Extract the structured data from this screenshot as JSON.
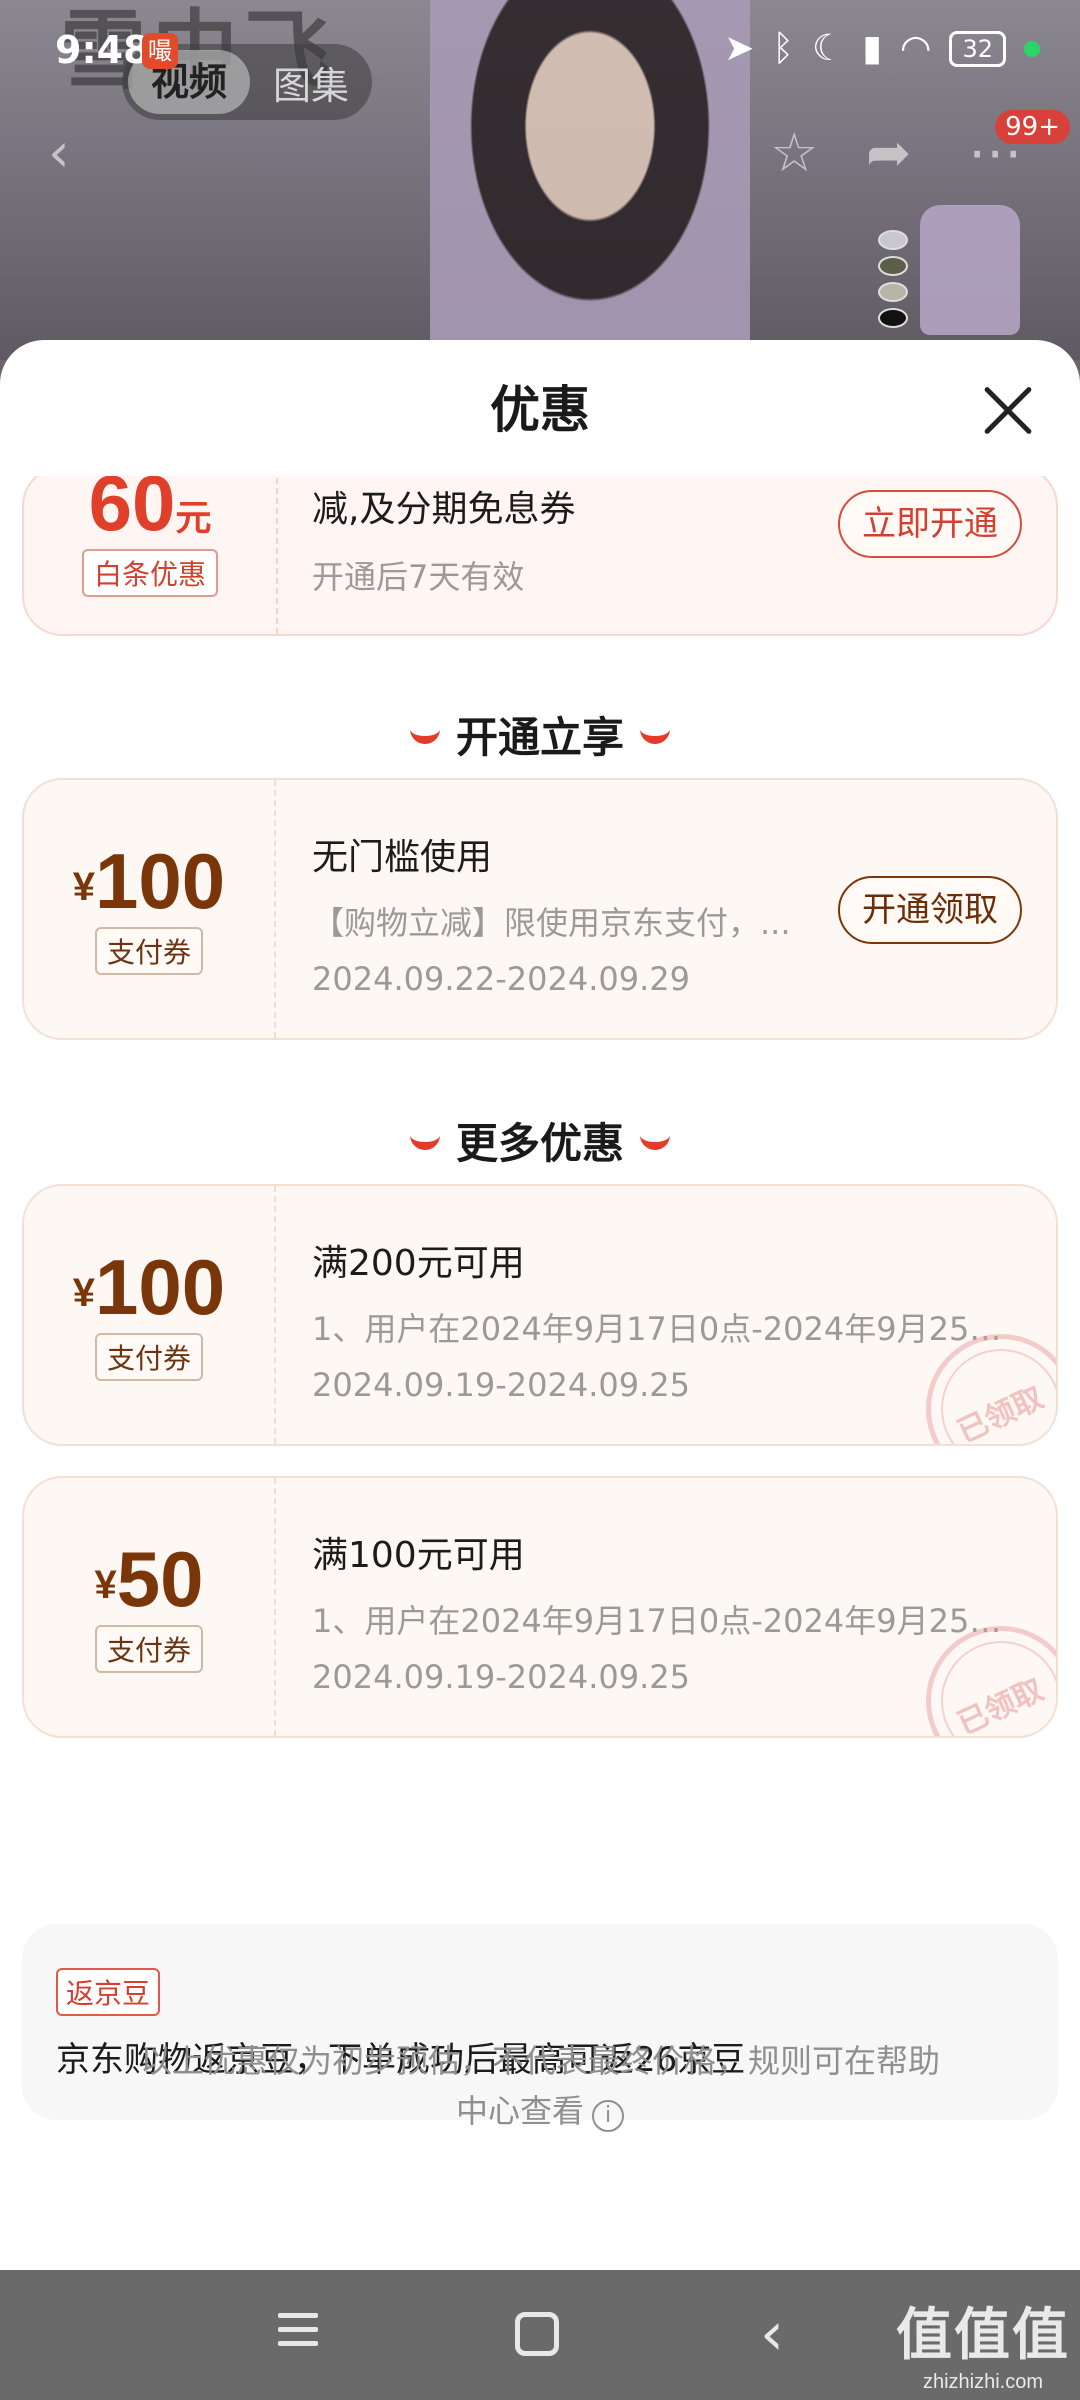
{
  "status_bar": {
    "time": "9:48",
    "app_badge": "嘬",
    "battery": "32"
  },
  "background": {
    "brand_text": "雪中飞",
    "tabs": [
      "视频",
      "图集"
    ],
    "cart_badge": "99+"
  },
  "sheet": {
    "title": "优惠",
    "baitiao_card": {
      "amount": "60",
      "unit": "元",
      "tag": "白条优惠",
      "line1": "减,及分期免息券",
      "line2": "开通后7天有效",
      "button": "立即开通"
    },
    "section_open": "开通立享",
    "open_card": {
      "yen": "¥",
      "amount": "100",
      "tag": "支付券",
      "line1": "无门槛使用",
      "line2": "【购物立减】限使用京东支付，...",
      "line3": "2024.09.22-2024.09.29",
      "button": "开通领取"
    },
    "section_more": "更多优惠",
    "coupons": [
      {
        "yen": "¥",
        "amount": "100",
        "tag": "支付券",
        "line1": "满200元可用",
        "line2": "1、用户在2024年9月17日0点-2024年9月25日...",
        "line3": "2024.09.19-2024.09.25",
        "stamp": "已领取"
      },
      {
        "yen": "¥",
        "amount": "50",
        "tag": "支付券",
        "line1": "满100元可用",
        "line2": "1、用户在2024年9月17日0点-2024年9月25日...",
        "line3": "2024.09.19-2024.09.25",
        "stamp": "已领取"
      }
    ],
    "jingdou": {
      "tag": "返京豆",
      "text": "京东购物返京豆，下单成功后最高可返26京豆"
    },
    "disclaimer": "以上优惠仅为初步预估，不代表最终价格，规则可在帮助中心查看",
    "info_icon": "i"
  },
  "watermark": {
    "main": "值值值",
    "url": "zhizhizhi.com"
  },
  "colors": {
    "accent_red": "#e0402a",
    "coupon_brown": "#7a3608",
    "card_bg": "#fef8f4"
  }
}
